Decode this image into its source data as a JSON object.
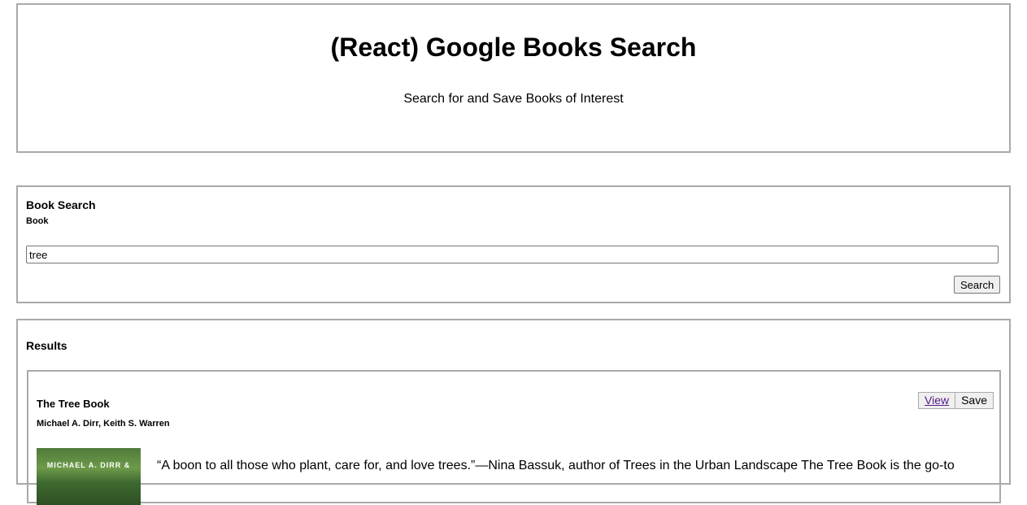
{
  "header": {
    "title": "(React) Google Books Search",
    "subtitle": "Search for and Save Books of Interest"
  },
  "search": {
    "panel_title": "Book Search",
    "field_label": "Book",
    "value": "tree",
    "button_label": "Search"
  },
  "results": {
    "panel_title": "Results",
    "books": [
      {
        "title": "The Tree Book",
        "authors": "Michael A. Dirr, Keith S. Warren",
        "view_label": "View",
        "save_label": "Save",
        "cover_text": "MICHAEL A. DIRR &",
        "description": "“A boon to all those who plant, care for, and love trees.”—Nina Bassuk, author of Trees in the Urban Landscape The Tree Book is the go-to"
      }
    ]
  }
}
